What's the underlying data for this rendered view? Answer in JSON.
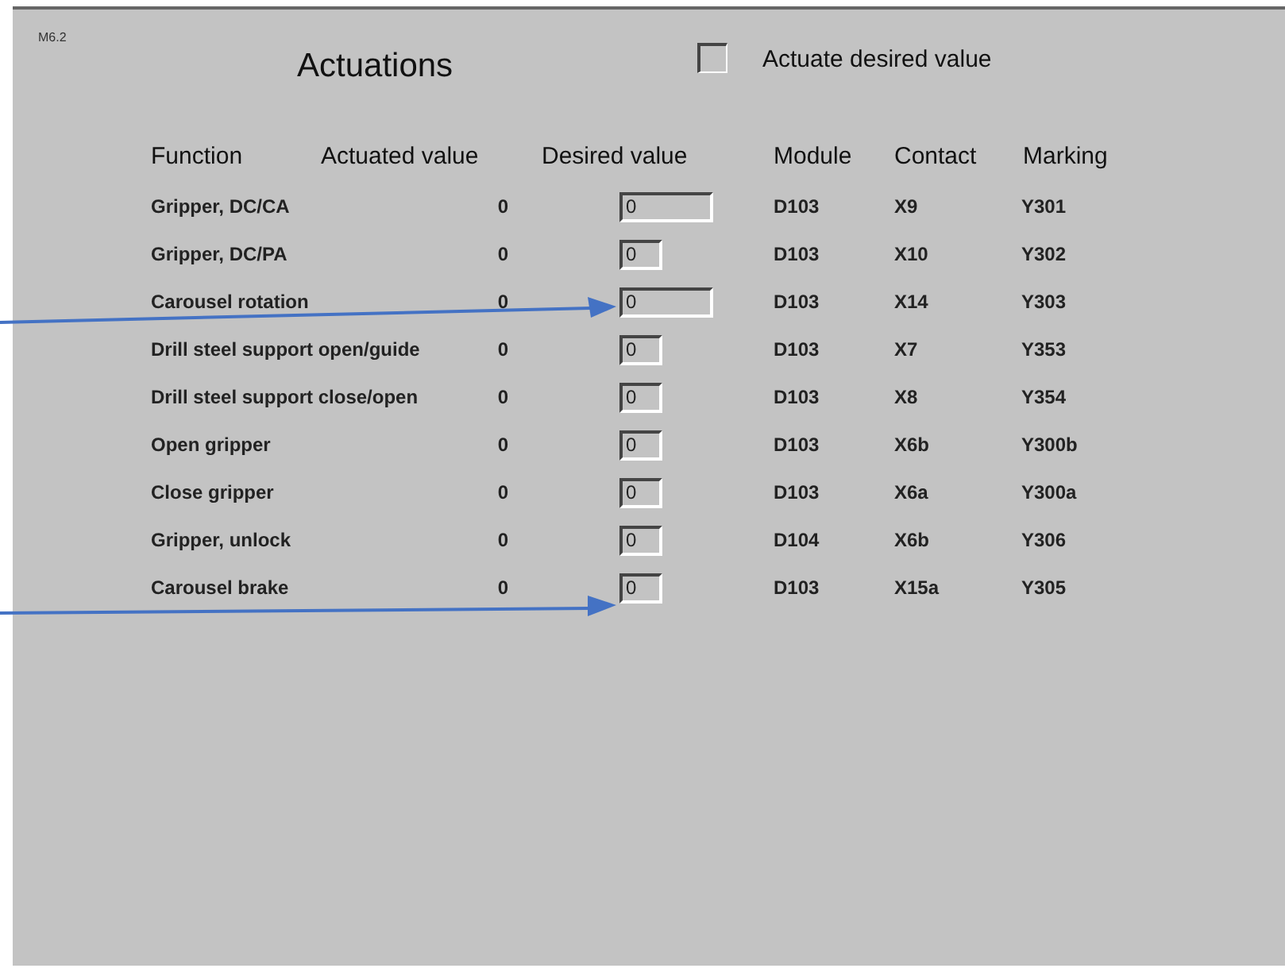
{
  "screen_id": "M6.2",
  "title": "Actuations",
  "actuate_checkbox": {
    "label": "Actuate desired value",
    "checked": false
  },
  "table": {
    "columns": [
      "Function",
      "Actuated value",
      "Desired value",
      "Module",
      "Contact",
      "Marking"
    ],
    "rows": [
      {
        "function": "Gripper, DC/CA",
        "actuated": "0",
        "desired": "0",
        "wide": true,
        "module": "D103",
        "contact": "X9",
        "marking": "Y301"
      },
      {
        "function": "Gripper, DC/PA",
        "actuated": "0",
        "desired": "0",
        "wide": false,
        "module": "D103",
        "contact": "X10",
        "marking": "Y302"
      },
      {
        "function": "Carousel rotation",
        "actuated": "0",
        "desired": "0",
        "wide": true,
        "module": "D103",
        "contact": "X14",
        "marking": "Y303"
      },
      {
        "function": "Drill steel support open/guide",
        "actuated": "0",
        "desired": "0",
        "wide": false,
        "module": "D103",
        "contact": "X7",
        "marking": "Y353"
      },
      {
        "function": "Drill steel support close/open",
        "actuated": "0",
        "desired": "0",
        "wide": false,
        "module": "D103",
        "contact": "X8",
        "marking": "Y354"
      },
      {
        "function": "Open gripper",
        "actuated": "0",
        "desired": "0",
        "wide": false,
        "module": "D103",
        "contact": "X6b",
        "marking": "Y300b"
      },
      {
        "function": "Close gripper",
        "actuated": "0",
        "desired": "0",
        "wide": false,
        "module": "D103",
        "contact": "X6a",
        "marking": "Y300a"
      },
      {
        "function": "Gripper, unlock",
        "actuated": "0",
        "desired": "0",
        "wide": false,
        "module": "D104",
        "contact": "X6b",
        "marking": "Y306"
      },
      {
        "function": "Carousel brake",
        "actuated": "0",
        "desired": "0",
        "wide": false,
        "module": "D103",
        "contact": "X15a",
        "marking": "Y305"
      }
    ]
  }
}
